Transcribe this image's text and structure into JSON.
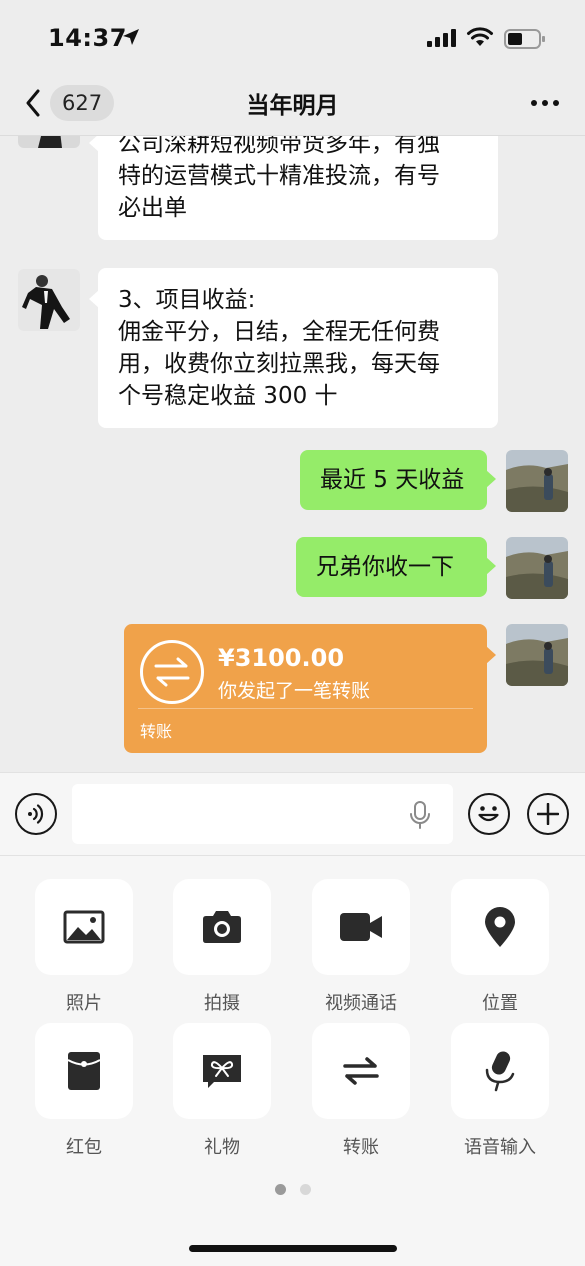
{
  "status_bar": {
    "time": "14:37"
  },
  "nav": {
    "back_count": "627",
    "title": "当年明月"
  },
  "messages": {
    "m1_lines": [
      "公司深耕短视频带货多年，有独",
      "特的运营模式十精准投流，有号",
      "必出单"
    ],
    "m2_lines": [
      "3、项目收益:",
      "佣金平分，日结，全程无任何费",
      "用，收费你立刻拉黑我，每天每",
      "个号稳定收益 300 十"
    ],
    "m3_text": "最近 5 天收益",
    "m4_text": "兄弟你收一下",
    "transfer": {
      "amount": "¥3100.00",
      "description": "你发起了一笔转账",
      "label": "转账",
      "color": "#f0a24a"
    }
  },
  "input": {
    "placeholder": ""
  },
  "panel": {
    "items": [
      {
        "label": "照片",
        "icon": "photo-icon"
      },
      {
        "label": "拍摄",
        "icon": "camera-icon"
      },
      {
        "label": "视频通话",
        "icon": "video-call-icon"
      },
      {
        "label": "位置",
        "icon": "location-icon"
      },
      {
        "label": "红包",
        "icon": "red-packet-icon"
      },
      {
        "label": "礼物",
        "icon": "gift-icon"
      },
      {
        "label": "转账",
        "icon": "transfer-icon"
      },
      {
        "label": "语音输入",
        "icon": "voice-input-icon"
      }
    ],
    "page_count": 2,
    "active_page": 1
  },
  "colors": {
    "background": "#ededed",
    "bubble_sent": "#95ec69",
    "bubble_received": "#ffffff",
    "transfer_card": "#f0a24a"
  }
}
